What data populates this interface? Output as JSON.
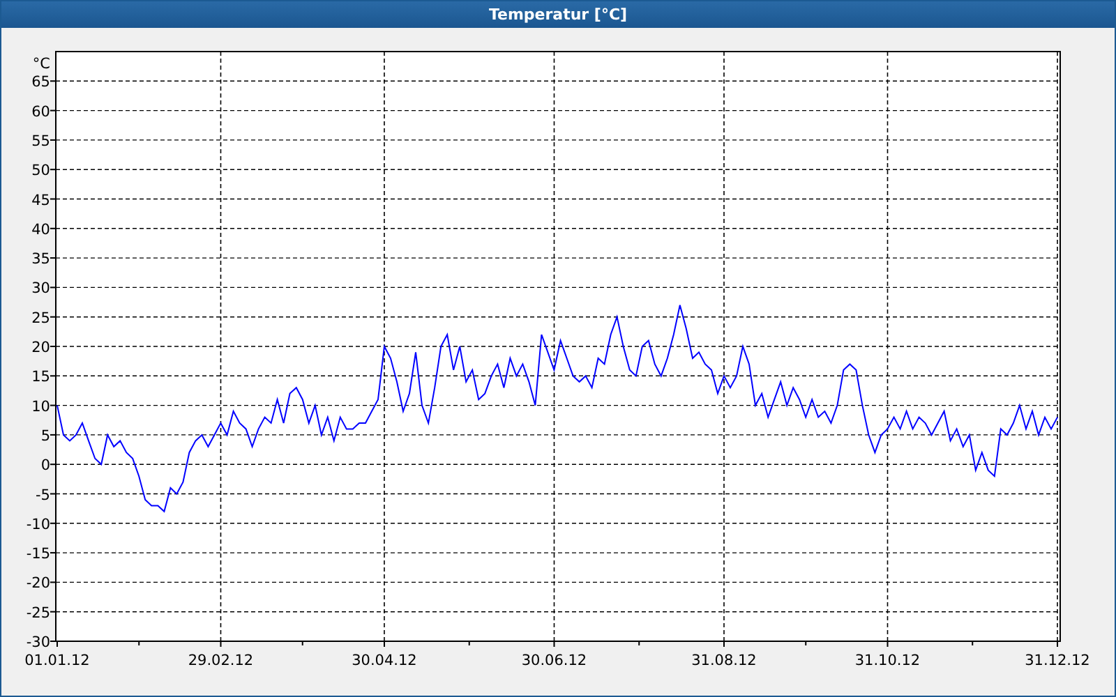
{
  "window": {
    "title": "Temperatur [°C]"
  },
  "chart": {
    "chart_data": {
      "type": "line",
      "grid": true,
      "ylabel": "°C",
      "ylim": [
        -30,
        70
      ],
      "yticks": [
        -30,
        -25,
        -20,
        -15,
        -10,
        -5,
        0,
        5,
        10,
        15,
        20,
        25,
        30,
        35,
        40,
        45,
        50,
        55,
        60,
        65
      ],
      "categories": [
        "01.01.12",
        null,
        null,
        null,
        null,
        null,
        null,
        null,
        null,
        null,
        null,
        null,
        null,
        null,
        null,
        null,
        null,
        null,
        null,
        null,
        null,
        null,
        null,
        null,
        null,
        null,
        "29.02.12",
        null,
        null,
        null,
        null,
        null,
        null,
        null,
        null,
        null,
        null,
        null,
        null,
        null,
        null,
        null,
        null,
        null,
        null,
        null,
        null,
        null,
        null,
        null,
        null,
        null,
        "30.04.12",
        null,
        null,
        null,
        null,
        null,
        null,
        null,
        null,
        null,
        null,
        null,
        null,
        null,
        null,
        null,
        null,
        null,
        null,
        null,
        null,
        null,
        null,
        null,
        null,
        null,
        null,
        "30.06.12",
        null,
        null,
        null,
        null,
        null,
        null,
        null,
        null,
        null,
        null,
        null,
        null,
        null,
        null,
        null,
        null,
        null,
        null,
        null,
        null,
        null,
        null,
        null,
        null,
        null,
        null,
        "31.08.12",
        null,
        null,
        null,
        null,
        null,
        null,
        null,
        null,
        null,
        null,
        null,
        null,
        null,
        null,
        null,
        null,
        null,
        null,
        null,
        null,
        null,
        null,
        null,
        null,
        null,
        "31.10.12",
        null,
        null,
        null,
        null,
        null,
        null,
        null,
        null,
        null,
        null,
        null,
        null,
        null,
        null,
        null,
        null,
        null,
        null,
        null,
        null,
        null,
        null,
        null,
        null,
        null,
        null,
        "31.12.12"
      ],
      "series": [
        {
          "color": "#0000ff",
          "values": [
            10,
            5,
            4,
            5,
            7,
            4,
            1,
            0,
            5,
            3,
            4,
            2,
            1,
            -2,
            -6,
            -7,
            -7,
            -8,
            -4,
            -5,
            -3,
            2,
            4,
            5,
            3,
            5,
            7,
            5,
            9,
            7,
            6,
            3,
            6,
            8,
            7,
            11,
            7,
            12,
            13,
            11,
            7,
            10,
            5,
            8,
            4,
            8,
            6,
            6,
            7,
            7,
            9,
            11,
            20,
            18,
            14,
            9,
            12,
            19,
            10,
            7,
            13,
            20,
            22,
            16,
            20,
            14,
            16,
            11,
            12,
            15,
            17,
            13,
            18,
            15,
            17,
            14,
            10,
            22,
            19,
            16,
            21,
            18,
            15,
            14,
            15,
            13,
            18,
            17,
            22,
            25,
            20,
            16,
            15,
            20,
            21,
            17,
            15,
            18,
            22,
            27,
            23,
            18,
            19,
            17,
            16,
            12,
            15,
            13,
            15,
            20,
            17,
            10,
            12,
            8,
            11,
            14,
            10,
            13,
            11,
            8,
            11,
            8,
            9,
            7,
            10,
            16,
            17,
            16,
            10,
            5,
            2,
            5,
            6,
            8,
            6,
            9,
            6,
            8,
            7,
            5,
            7,
            9,
            4,
            6,
            3,
            5,
            -1,
            2,
            -1,
            -2,
            6,
            5,
            7,
            10,
            6,
            9,
            5,
            8,
            6,
            8
          ]
        }
      ]
    }
  }
}
